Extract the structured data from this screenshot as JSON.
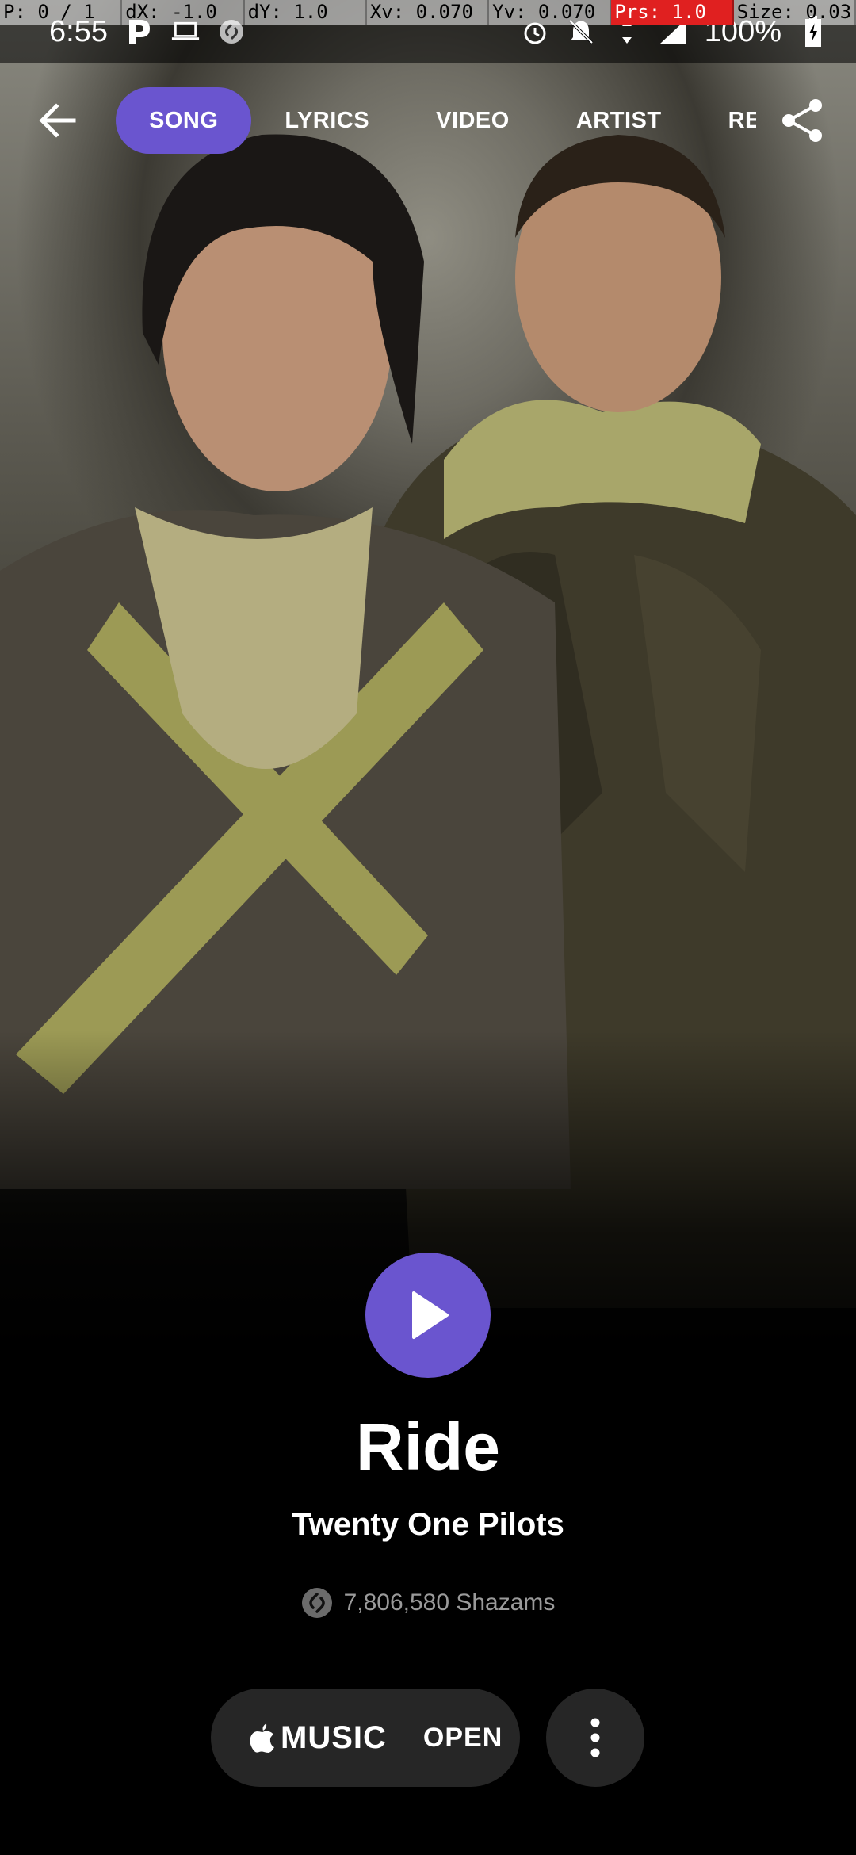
{
  "debug_overlay": {
    "pointer": "P: 0 / 1",
    "dx": "dX: -1.0",
    "dy": "dY: 1.0",
    "xv": "Xv: 0.070",
    "yv": "Yv: 0.070",
    "prs": "Prs: 1.0",
    "size": "Size: 0.03"
  },
  "status_bar": {
    "time": "6:55",
    "battery": "100%",
    "left_icons": [
      "pandora-icon",
      "laptop-icon",
      "shazam-icon"
    ],
    "right_icons": [
      "alarm-icon",
      "mute-icon",
      "data-arrows-icon",
      "signal-icon",
      "battery-charging-icon"
    ]
  },
  "nav": {
    "tabs": [
      {
        "label": "SONG",
        "active": true
      },
      {
        "label": "LYRICS",
        "active": false
      },
      {
        "label": "VIDEO",
        "active": false
      },
      {
        "label": "ARTIST",
        "active": false
      },
      {
        "label": "RELATED",
        "active": false
      }
    ]
  },
  "song": {
    "title": "Ride",
    "artist": "Twenty One Pilots",
    "shazam_count": "7,806,580 Shazams"
  },
  "actions": {
    "music_label": "MUSIC",
    "open_label": "OPEN"
  },
  "colors": {
    "accent": "#6a55cf",
    "button_bg": "#262626",
    "muted_text": "#9a9a9a"
  }
}
